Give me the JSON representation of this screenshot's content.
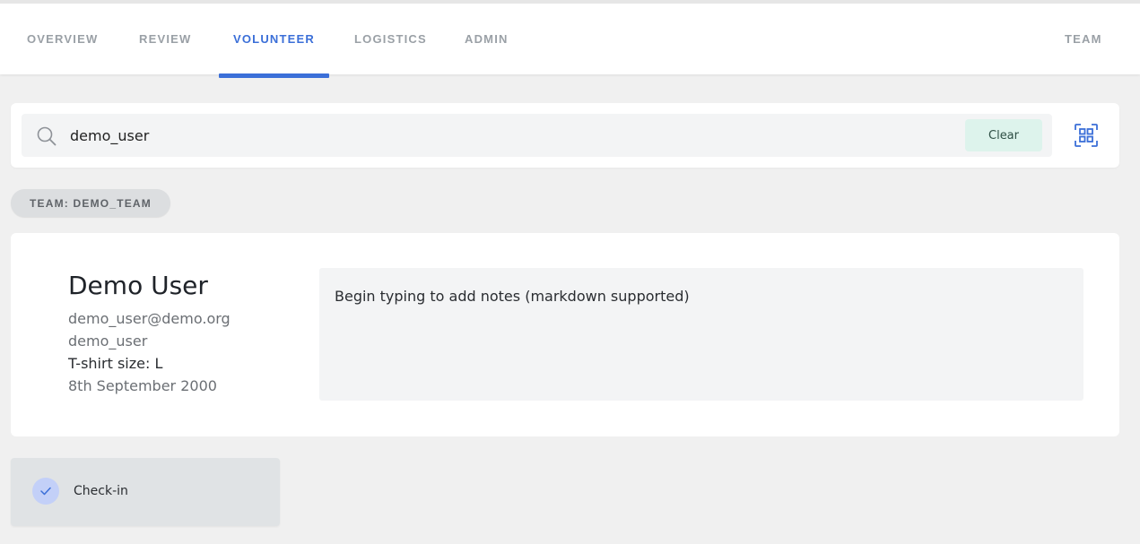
{
  "nav": {
    "tabs": [
      {
        "label": "OVERVIEW",
        "active": false
      },
      {
        "label": "REVIEW",
        "active": false
      },
      {
        "label": "VOLUNTEER",
        "active": true
      },
      {
        "label": "LOGISTICS",
        "active": false
      },
      {
        "label": "ADMIN",
        "active": false
      }
    ],
    "team_link": "TEAM"
  },
  "search": {
    "value": "demo_user",
    "clear_label": "Clear",
    "icons": {
      "search": "search-icon",
      "scan": "qr-scan-icon"
    }
  },
  "team_badge": "TEAM: DEMO_TEAM",
  "user": {
    "name": "Demo User",
    "email": "demo_user@demo.org",
    "username": "demo_user",
    "tshirt": "T-shirt size: L",
    "dob": "8th September 2000"
  },
  "notes": {
    "placeholder": "Begin typing to add notes (markdown supported)",
    "value": ""
  },
  "checkin": {
    "label": "Check-in",
    "icon": "check-icon"
  },
  "colors": {
    "accent": "#3b6fd8",
    "clear_button_bg": "#ddf3ec",
    "checkin_icon_bg": "#c3d0f8",
    "page_bg": "#f0f0f0"
  }
}
